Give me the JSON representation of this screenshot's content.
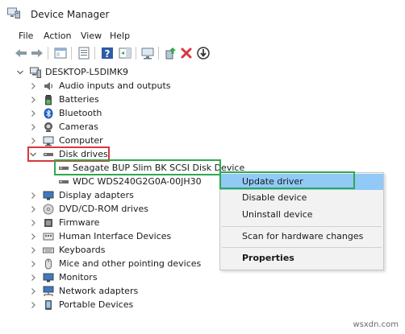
{
  "window": {
    "title": "Device Manager"
  },
  "menu": [
    "File",
    "Action",
    "View",
    "Help"
  ],
  "tree": {
    "root": "DESKTOP-L5DIMK9",
    "items": [
      {
        "label": "Audio inputs and outputs",
        "icon": "speaker-icon"
      },
      {
        "label": "Batteries",
        "icon": "battery-icon"
      },
      {
        "label": "Bluetooth",
        "icon": "bluetooth-icon"
      },
      {
        "label": "Cameras",
        "icon": "camera-icon"
      },
      {
        "label": "Computer",
        "icon": "computer-icon"
      },
      {
        "label": "Disk drives",
        "icon": "disk-drive-icon",
        "expanded": true,
        "children": [
          {
            "label": "Seagate BUP Slim BK SCSI Disk Device",
            "selected": true
          },
          {
            "label": "WDC WDS240G2G0A-00JH30"
          }
        ]
      },
      {
        "label": "Display adapters",
        "icon": "monitor-icon"
      },
      {
        "label": "DVD/CD-ROM drives",
        "icon": "dvd-drive-icon"
      },
      {
        "label": "Firmware",
        "icon": "firmware-icon"
      },
      {
        "label": "Human Interface Devices",
        "icon": "hid-icon"
      },
      {
        "label": "Keyboards",
        "icon": "keyboard-icon"
      },
      {
        "label": "Mice and other pointing devices",
        "icon": "mouse-icon"
      },
      {
        "label": "Monitors",
        "icon": "monitor-icon"
      },
      {
        "label": "Network adapters",
        "icon": "network-icon"
      },
      {
        "label": "Portable Devices",
        "icon": "portable-device-icon"
      }
    ]
  },
  "context_menu": {
    "items": [
      "Update driver",
      "Disable device",
      "Uninstall device",
      "Scan for hardware changes",
      "Properties"
    ],
    "highlighted": "Update driver"
  },
  "watermark": "wsxdn.com",
  "colors": {
    "highlight_red": "#d9363e",
    "highlight_green": "#2fa84f",
    "menu_selection": "#91c9f7"
  }
}
